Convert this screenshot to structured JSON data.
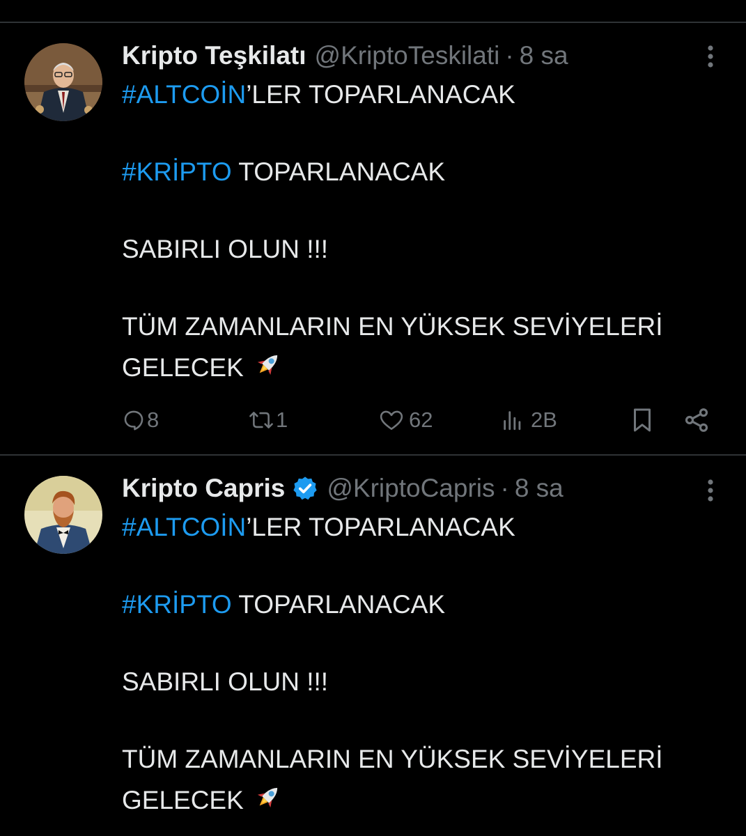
{
  "colors": {
    "background": "#000000",
    "text": "#e7e9ea",
    "muted": "#71767b",
    "link": "#1d9bf0",
    "divider": "#2f3336",
    "verified": "#1d9bf0"
  },
  "tweets": [
    {
      "name": "Kripto Teşkilatı",
      "handle": "@KriptoTeskilati",
      "separator": "·",
      "time": "8 sa",
      "verified": false,
      "avatar_icon": "avatar-old-man-suit",
      "lines": [
        {
          "hashtag": "#ALTCOİN",
          "rest": "’LER TOPARLANACAK"
        },
        {
          "hashtag": "#KRİPTO",
          "rest": " TOPARLANACAK"
        },
        {
          "text": "SABIRLI OLUN !!!"
        },
        {
          "text": "TÜM ZAMANLARIN EN YÜKSEK SEVİYELERİ"
        },
        {
          "text": "GELECEK",
          "emoji": "rocket-icon"
        }
      ],
      "stats": {
        "replies": "8",
        "reposts": "1",
        "likes": "62",
        "views": "2B"
      }
    },
    {
      "name": "Kripto Capris",
      "handle": "@KriptoCapris",
      "separator": "·",
      "time": "8 sa",
      "verified": true,
      "avatar_icon": "avatar-bearded-man-tuxedo",
      "lines": [
        {
          "hashtag": "#ALTCOİN",
          "rest": "’LER TOPARLANACAK"
        },
        {
          "hashtag": "#KRİPTO",
          "rest": " TOPARLANACAK"
        },
        {
          "text": "SABIRLI OLUN !!!"
        },
        {
          "text": "TÜM ZAMANLARIN EN YÜKSEK SEVİYELERİ"
        },
        {
          "text": "GELECEK",
          "emoji": "rocket-icon"
        }
      ]
    }
  ]
}
